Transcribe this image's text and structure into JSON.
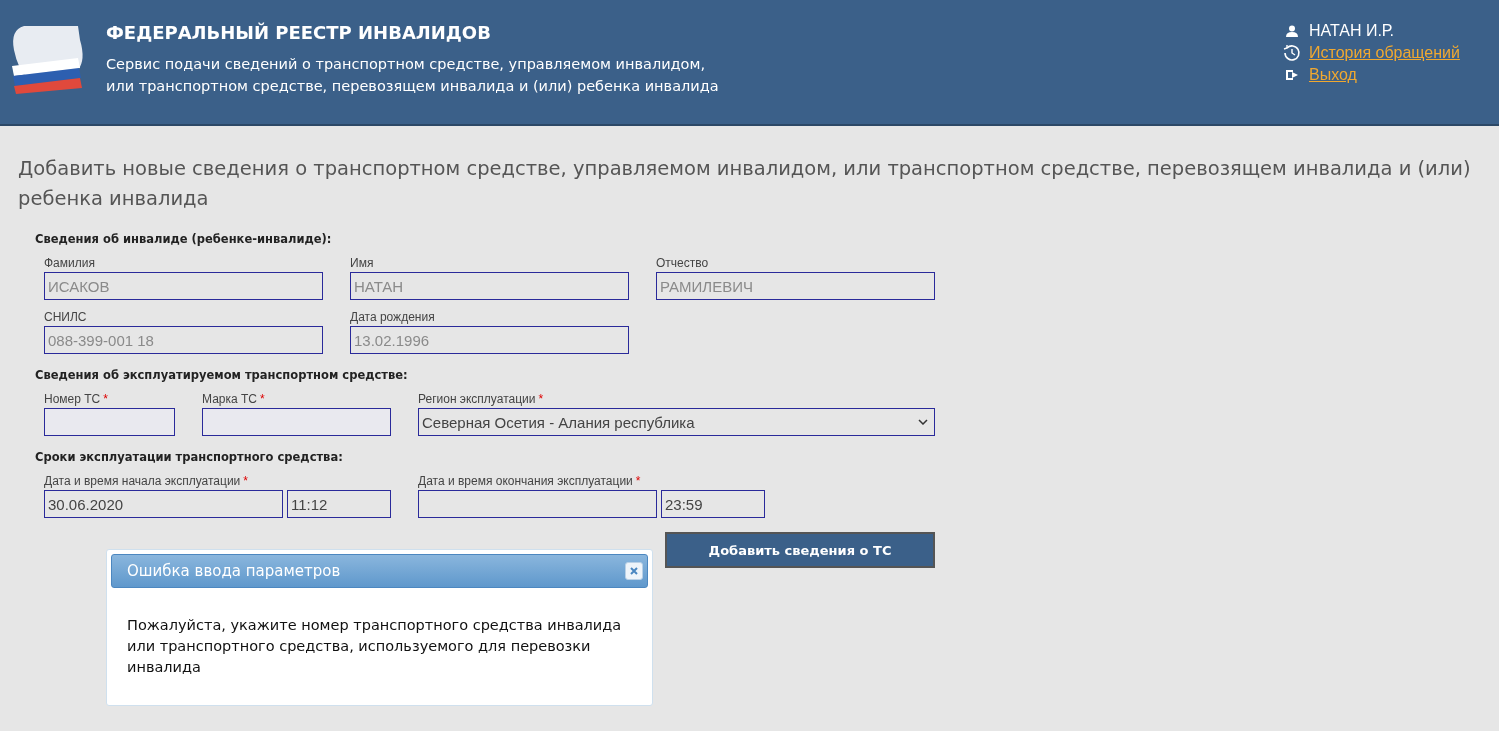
{
  "header": {
    "title": "ФЕДЕРАЛЬНЫЙ РЕЕСТР ИНВАЛИДОВ",
    "subtitle_lines": [
      "Сервис подачи сведений о транспортном средстве, управляемом инвалидом,",
      "или транспортном средстве, перевозящем инвалида и (или) ребенка инвалида"
    ],
    "user": "НАТАН И.Р.",
    "links": [
      {
        "kind": "history",
        "label": "История обращений"
      },
      {
        "kind": "logout",
        "label": "Выход"
      }
    ]
  },
  "page_title": "Добавить новые сведения о транспортном средстве, управляемом инвалидом, или транспортном средстве, перевозящем инвалида и (или) ребенка инвалида",
  "sections": [
    {
      "title": "Сведения об инвалиде (ребенке-инвалиде):",
      "rows": [
        [
          {
            "label": "Фамилия",
            "value": "ИСАКОВ",
            "kind": "input",
            "disabled": true
          },
          {
            "label": "Имя",
            "value": "НАТАН",
            "kind": "input",
            "disabled": true
          },
          {
            "label": "Отчество",
            "value": "РАМИЛЕВИЧ",
            "kind": "input",
            "disabled": true
          }
        ],
        [
          {
            "label": "СНИЛС",
            "value": "088-399-001 18",
            "kind": "input",
            "disabled": true
          },
          {
            "label": "Дата рождения",
            "value": "13.02.1996",
            "kind": "input",
            "disabled": true
          }
        ]
      ]
    },
    {
      "title": "Сведения об эксплуатируемом транспортном средстве:",
      "rows": [
        [
          {
            "label": "Номер ТС",
            "required_mark": "*",
            "kind": "input"
          },
          {
            "label": "Марка ТС",
            "required_mark": "*",
            "kind": "input"
          },
          {
            "label": "Регион эксплуатации",
            "required_mark": "*",
            "value": "Северная Осетия - Алания республика",
            "kind": "select"
          }
        ]
      ]
    },
    {
      "title": "Сроки эксплуатации транспортного средства:",
      "rows": [
        [
          {
            "kind": "datetime",
            "label": "Дата и время начала эксплуатации",
            "required_mark": "*",
            "date": "30.06.2020",
            "time": "11:12"
          },
          {
            "kind": "datetime",
            "label": "Дата и время окончания эксплуатации",
            "required_mark": "*",
            "time": "23:59"
          }
        ]
      ]
    }
  ],
  "submit": "Добавить сведения о ТС",
  "dialog": {
    "title": "Ошибка ввода параметров",
    "message": "Пожалуйста, укажите номер транспортного средства инвалида или транспортного средства, используемого для перевозки инвалида"
  }
}
